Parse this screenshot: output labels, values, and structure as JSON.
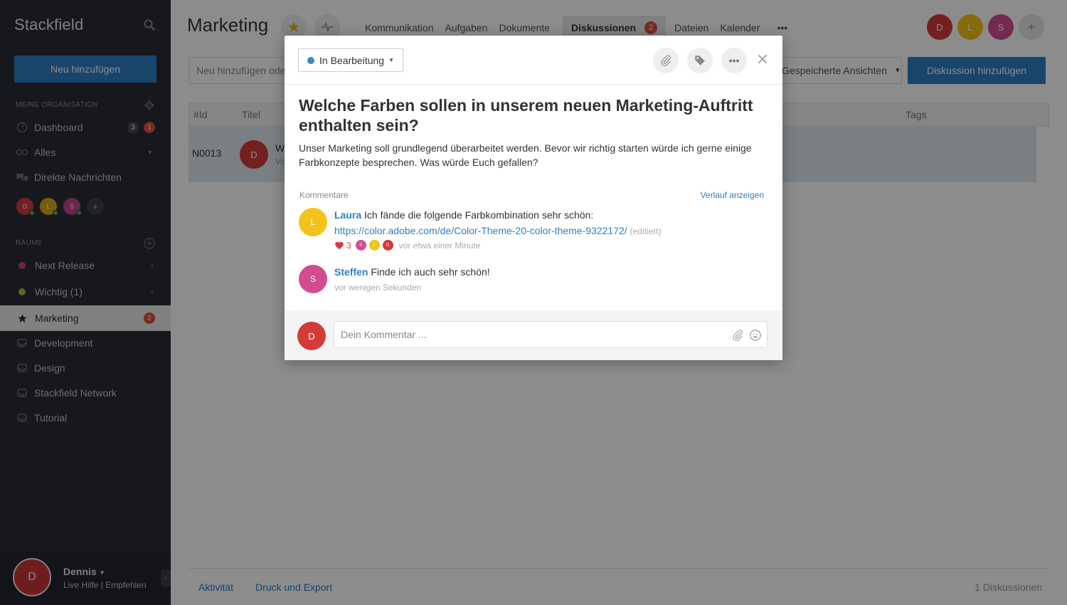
{
  "sidebar": {
    "brand": "Stackfield",
    "new_button": "Neu hinzufügen",
    "org_section": "MEINE ORGANISATION",
    "org_items": [
      {
        "label": "Dashboard",
        "badge_gray": "3",
        "badge_red": "1"
      },
      {
        "label": "Alles"
      },
      {
        "label": "Direkte Nachrichten"
      }
    ],
    "member_initials": [
      "D",
      "L",
      "S"
    ],
    "rooms_section": "RÄUME",
    "rooms": [
      {
        "label": "Next Release",
        "color": "#c2456d"
      },
      {
        "label": "Wichtig (1)",
        "color": "#a6b83a"
      },
      {
        "label": "Marketing",
        "badge": "2"
      },
      {
        "label": "Development"
      },
      {
        "label": "Design"
      },
      {
        "label": "Stackfield Network"
      },
      {
        "label": "Tutorial"
      }
    ],
    "user": {
      "initial": "D",
      "name": "Dennis",
      "help": "Live Hilfe",
      "sep": "|",
      "recommend": "Empfehlen"
    }
  },
  "main": {
    "title": "Marketing",
    "tabs": [
      {
        "label": "Kommunikation"
      },
      {
        "label": "Aufgaben"
      },
      {
        "label": "Dokumente"
      },
      {
        "label": "Diskussionen",
        "badge": "2"
      },
      {
        "label": "Dateien"
      },
      {
        "label": "Kalender"
      },
      {
        "label": "•••"
      }
    ],
    "members": [
      {
        "initial": "D",
        "color": "#d33b3b"
      },
      {
        "initial": "L",
        "color": "#f2c31b"
      },
      {
        "initial": "S",
        "color": "#d44b92"
      },
      {
        "initial": "+",
        "color": "#e6e6e6"
      }
    ],
    "add_placeholder": "Neu hinzufügen oder ...",
    "views": "Gespeicherte Ansichten",
    "add_discussion": "Diskussion hinzufügen",
    "columns": {
      "id": "#Id",
      "title": "Titel",
      "tags": "Tags"
    },
    "row": {
      "id": "N0013",
      "avatar": "D",
      "title_start": "W",
      "sub_start": "Vo"
    },
    "footer": {
      "activity": "Aktivität",
      "print": "Druck und Export",
      "count": "1 Diskussionen"
    }
  },
  "modal": {
    "status": "In Bearbeitung",
    "status_color": "#3a86cc",
    "title": "Welche Farben sollen in unserem neuen Marketing-Auftritt enthalten sein?",
    "description": "Unser Marketing soll grundlegend überarbeitet werden. Bevor wir richtig starten würde ich gerne einige Farbkonzepte besprechen. Was würde Euch gefallen?",
    "comments_label": "Kommentare",
    "history_link": "Verlauf anzeigen",
    "comments": [
      {
        "initial": "L",
        "color": "#f2c31b",
        "author": "Laura",
        "text": "Ich fände die folgende Farbkombination sehr schön:",
        "link": "https://color.adobe.com/de/Color-Theme-20-color-theme-9322172/",
        "edited": "(editiert)",
        "likes": "3",
        "reactors": [
          {
            "initial": "S",
            "color": "#d44b92"
          },
          {
            "initial": "L",
            "color": "#f2c31b"
          },
          {
            "initial": "D",
            "color": "#d33b3b"
          }
        ],
        "time": "vor etwa einer Minute"
      },
      {
        "initial": "S",
        "color": "#d44b92",
        "author": "Steffen",
        "text": "Finde ich auch sehr schön!",
        "time": "vor wenigen Sekunden"
      }
    ],
    "composer": {
      "initial": "D",
      "placeholder": "Dein Kommentar ..."
    }
  }
}
